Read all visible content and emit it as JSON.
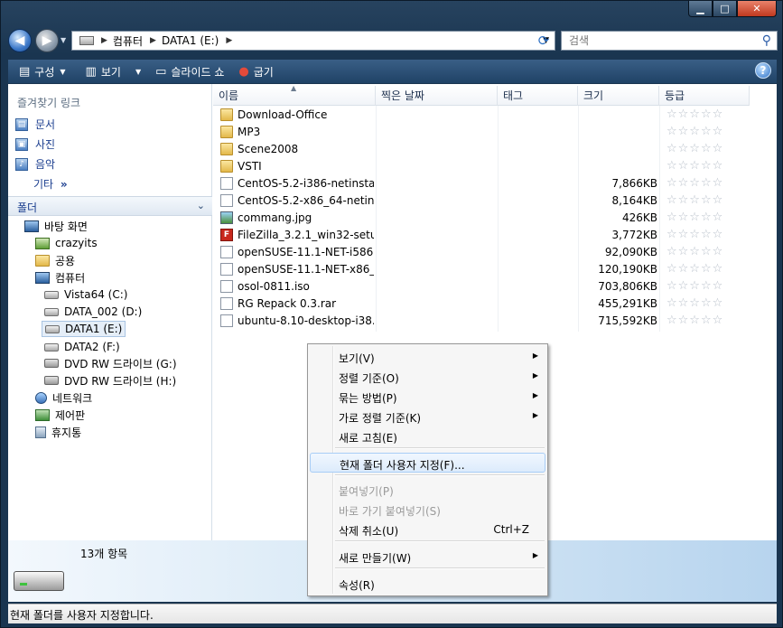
{
  "window": {
    "controls": {
      "minimize_icon": "minimize-icon",
      "maximize_icon": "maximize-icon",
      "close_icon": "close-icon"
    }
  },
  "address": {
    "segments": [
      "컴퓨터",
      "DATA1 (E:)"
    ]
  },
  "search": {
    "placeholder": "검색"
  },
  "toolbar": {
    "organize": "구성",
    "views": "보기",
    "slideshow": "슬라이드 쇼",
    "burn": "굽기"
  },
  "nav": {
    "favorites_title": "즐겨찾기 링크",
    "favorites": [
      "문서",
      "사진",
      "음악"
    ],
    "more": "기타",
    "more_chevron": "»",
    "folders_title": "폴더",
    "tree": [
      "바탕 화면",
      "crazyits",
      "공용",
      "컴퓨터",
      "Vista64 (C:)",
      "DATA_002 (D:)",
      "DATA1 (E:)",
      "DATA2 (F:)",
      "DVD RW 드라이브 (G:)",
      "DVD RW 드라이브 (H:)",
      "네트워크",
      "제어판",
      "휴지통"
    ]
  },
  "columns": [
    "이름",
    "찍은 날짜",
    "태그",
    "크기",
    "등급"
  ],
  "files": [
    {
      "name": "Download-Office",
      "size": "",
      "type": "folder"
    },
    {
      "name": "MP3",
      "size": "",
      "type": "folder"
    },
    {
      "name": "Scene2008",
      "size": "",
      "type": "folder"
    },
    {
      "name": "VSTI",
      "size": "",
      "type": "folder"
    },
    {
      "name": "CentOS-5.2-i386-netinsta...",
      "size": "7,866KB",
      "type": "file"
    },
    {
      "name": "CentOS-5.2-x86_64-netin...",
      "size": "8,164KB",
      "type": "file"
    },
    {
      "name": "commang.jpg",
      "size": "426KB",
      "type": "image"
    },
    {
      "name": "FileZilla_3.2.1_win32-setu...",
      "size": "3,772KB",
      "type": "filezilla"
    },
    {
      "name": "openSUSE-11.1-NET-i586...",
      "size": "92,090KB",
      "type": "file"
    },
    {
      "name": "openSUSE-11.1-NET-x86_...",
      "size": "120,190KB",
      "type": "file"
    },
    {
      "name": "osol-0811.iso",
      "size": "703,806KB",
      "type": "file"
    },
    {
      "name": "RG Repack 0.3.rar",
      "size": "455,291KB",
      "type": "file"
    },
    {
      "name": "ubuntu-8.10-desktop-i38...",
      "size": "715,592KB",
      "type": "file"
    }
  ],
  "rating_stars": "☆☆☆☆☆",
  "details": {
    "count": "13개 항목"
  },
  "status": {
    "text": "현재 폴더를 사용자 지정합니다."
  },
  "context_menu": {
    "items": [
      {
        "label": "보기(V)",
        "submenu": true
      },
      {
        "label": "정렬 기준(O)",
        "submenu": true
      },
      {
        "label": "묶는 방법(P)",
        "submenu": true
      },
      {
        "label": "가로 정렬 기준(K)",
        "submenu": true
      },
      {
        "label": "새로 고침(E)"
      },
      {
        "label": "현재 폴더 사용자 지정(F)...",
        "highlighted": true
      },
      {
        "label": "붙여넣기(P)",
        "disabled": true
      },
      {
        "label": "바로 가기 붙여넣기(S)",
        "disabled": true
      },
      {
        "label": "삭제 취소(U)",
        "shortcut": "Ctrl+Z"
      },
      {
        "label": "새로 만들기(W)",
        "submenu": true
      },
      {
        "label": "속성(R)"
      }
    ]
  }
}
